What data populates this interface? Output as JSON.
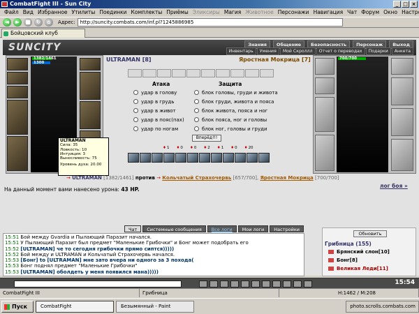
{
  "window": {
    "title": "CombatFight III - Sun City"
  },
  "menu": [
    "Файл",
    "Вид",
    "Избранное",
    "Утилиты",
    "Поединки",
    "Комплекты",
    "Приёмы",
    "Эликсиры",
    "Магия",
    "Животное",
    "Персонажи",
    "Навигация",
    "Чат",
    "Форум",
    "Окно",
    "Настройки",
    "?"
  ],
  "menu_dim": [
    "Эликсиры",
    "Животное"
  ],
  "address": {
    "label": "Адрес:",
    "url": "http://suncity.combats.com/inf.pl?1245886985"
  },
  "tab": {
    "label": "Бойцовский клуб"
  },
  "game": {
    "logo": "SUNCITY",
    "nav_top": [
      "Знания",
      "Общение",
      "Безопасность",
      "Персонаж",
      "Выход"
    ],
    "nav_bottom": [
      "Инвентарь",
      "Умения",
      "Мой Скроллл",
      "Отчет о переводах",
      "Подарки",
      "Анкета"
    ],
    "player": {
      "name": "ULTRAMAN [8]",
      "hp": "1382/1461",
      "mana": "1300"
    },
    "enemy": {
      "name": "Яростная Мокрица [7]",
      "hp": "700/700"
    },
    "tooltip": {
      "name": "ULTRAMAN",
      "stats": [
        "Сила: 35",
        "Ловкость: 10",
        "Интуиция: 3",
        "Выносливость: 75"
      ],
      "spirit": "Уровень духа: 20.00"
    },
    "attack_header": "Атака",
    "defense_header": "Защита",
    "attacks": [
      "удар в голову",
      "удар в грудь",
      "удар в живот",
      "удар в пояс(пах)",
      "удар по ногам"
    ],
    "defenses": [
      "блок головы, груди и живота",
      "блок груди, живота и пояса",
      "блок живота, пояса и ног",
      "блок пояса, ног и головы",
      "блок ног, головы и груди"
    ],
    "go_button": "Вперёд!!!",
    "counters": [
      "1",
      "0",
      "0",
      "2",
      "1",
      "0",
      "20"
    ],
    "vs": {
      "ally": "ULTRAMAN",
      "ally_hp": "[1382/1461]",
      "word": "против",
      "foe1": "Кольчатый Страхочервь",
      "foe1_hp": "[657/700],",
      "foe2": "Яростная Мокрица",
      "foe2_hp": "[700/700]"
    },
    "damage_text": "На данный момент вами нанесено урона:",
    "damage_value": "43 HP.",
    "log_link": "лог боя »",
    "chat_tabs": [
      "Чат",
      "Системные сообщения",
      "Все логи",
      "Мои логи",
      "Настройки"
    ],
    "chat": [
      {
        "time": "15:51",
        "text": "Бой между Gvardia и Пылающий Паразит начался."
      },
      {
        "time": "15:51",
        "text": "У Пылающий Паразит был предмет \"Маленькие Грибочки\" и Бонг может подобрать его"
      },
      {
        "time": "15:52",
        "text": "[ULTRAMAN] че то сегодня грибочки прямо сиптся)))))"
      },
      {
        "time": "15:52",
        "text": "Бой между и ULTRAMAN и Кольчатый Страхочервь начался."
      },
      {
        "time": "15:53",
        "text": "[Бонг] to [ULTRAMAN] мне зато вчера ни одного за 3 похода("
      },
      {
        "time": "15:53",
        "text": "Бонг поднял предмет \"Маленькие Грибочки\""
      },
      {
        "time": "15:53",
        "text": "[ULTRAMAN] оболдеть у меня появился мана)))))"
      }
    ],
    "refresh_button": "Обновить",
    "location": "Грибница (155)",
    "players": [
      "Брянский слон[10]",
      "Бонг[8]",
      "Великая Леди[11]"
    ],
    "clock": "15:54"
  },
  "statusbar": [
    "CombatFight III",
    "Грибница",
    "H:1462 / M:208"
  ],
  "taskbar": {
    "start": "Пуск",
    "items": [
      "CombatFight",
      "Безымянный - Paint"
    ],
    "tray": "photo.scrolls.combats.com"
  }
}
